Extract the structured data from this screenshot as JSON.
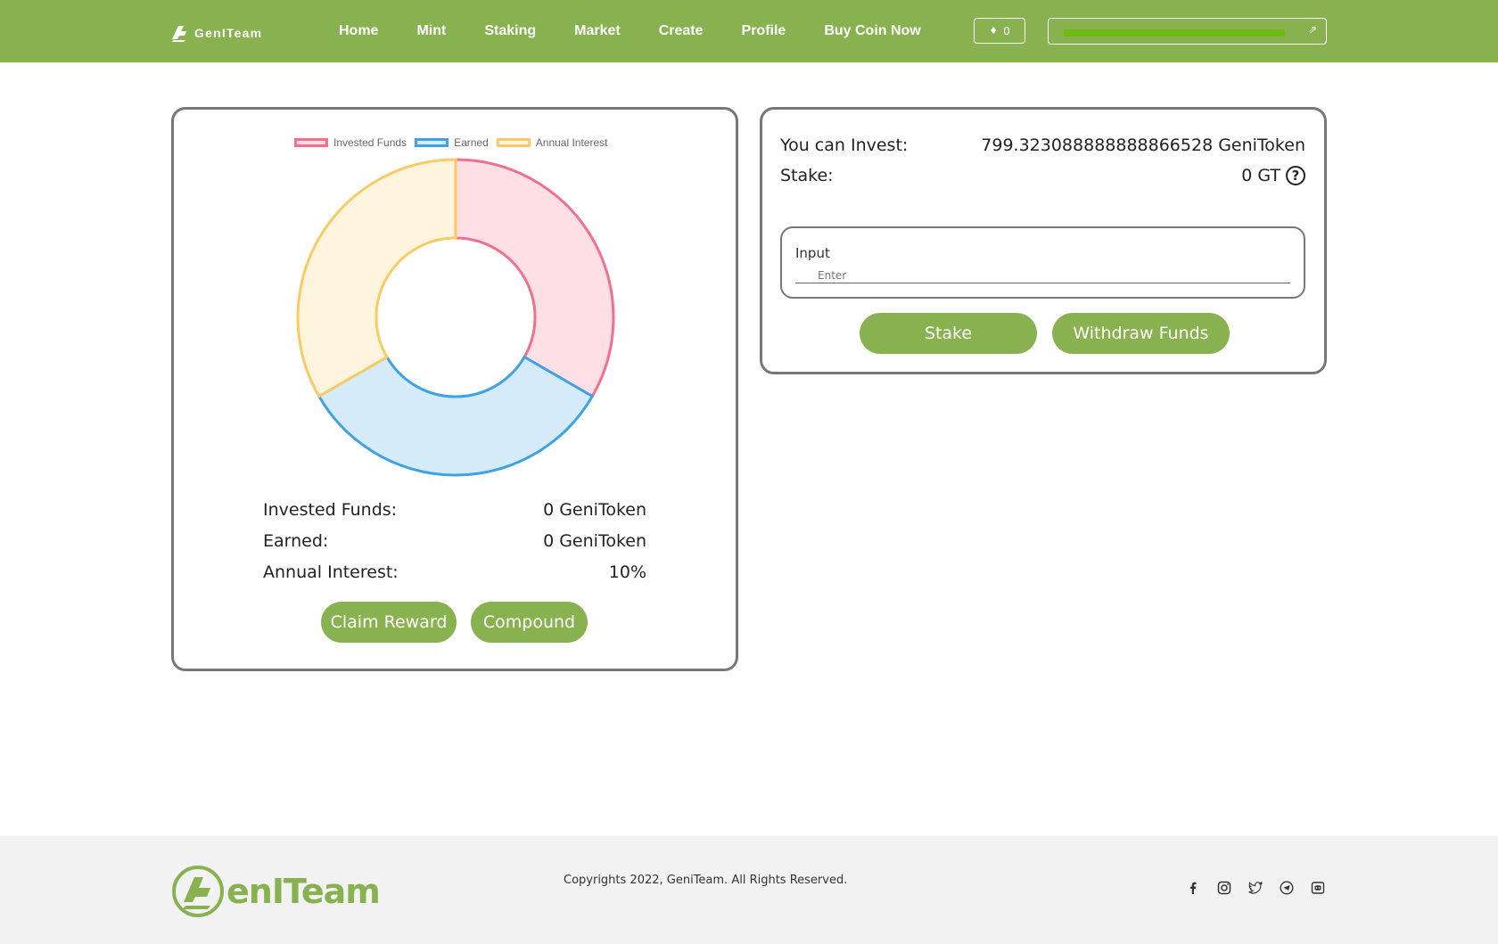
{
  "brand": {
    "name": "GenITeam"
  },
  "nav": {
    "links": [
      "Home",
      "Mint",
      "Staking",
      "Market",
      "Create",
      "Profile",
      "Buy Coin Now"
    ],
    "eth_balance": "0",
    "wallet_icon": "external-link-icon"
  },
  "chart_data": {
    "type": "pie",
    "labels": [
      "Invested Funds",
      "Earned",
      "Annual Interest"
    ],
    "values": [
      1,
      1,
      1
    ],
    "colors": {
      "fill": [
        "#ffdfe6",
        "#d6ebf9",
        "#fff4de"
      ],
      "stroke": [
        "#f2708e",
        "#3ea2e3",
        "#f8cc63"
      ]
    },
    "legend_position": "top"
  },
  "stats": {
    "invested_label": "Invested Funds:",
    "invested_value": "0 GeniToken",
    "earned_label": "Earned:",
    "earned_value": "0 GeniToken",
    "interest_label": "Annual Interest:",
    "interest_value": "10%"
  },
  "actions": {
    "claim": "Claim Reward",
    "compound": "Compound"
  },
  "invest": {
    "can_invest_label": "You can Invest:",
    "can_invest_value": "799.323088888888866528 GeniToken",
    "stake_label": "Stake:",
    "stake_value": "0 GT",
    "input_label": "Input",
    "input_placeholder": "Enter",
    "stake_button": "Stake",
    "withdraw_button": "Withdraw Funds"
  },
  "footer": {
    "logo_text": "enITeam",
    "copyright": "Copyrights 2022, GeniTeam. All Rights Reserved.",
    "social_icons": [
      "facebook-icon",
      "instagram-icon",
      "twitter-icon",
      "telegram-icon",
      "discord-icon"
    ]
  },
  "colors": {
    "brand_green": "#88b24f",
    "border_gray": "#777777"
  }
}
